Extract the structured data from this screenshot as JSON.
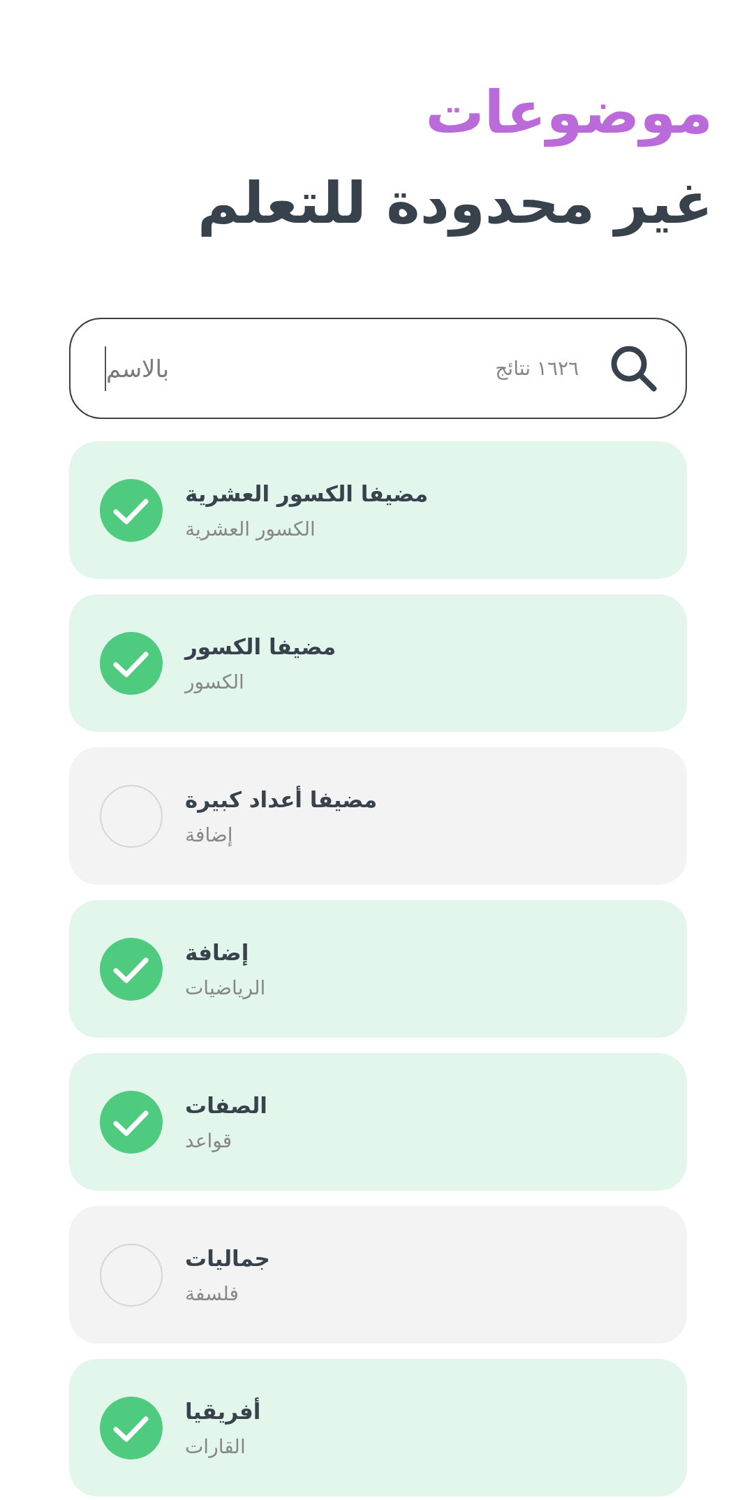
{
  "title": {
    "accent": "موضوعات",
    "main": "غير محدودة للتعلم"
  },
  "search": {
    "placeholder": "بالاسم",
    "result_count": "١٦٢٦ نتائج"
  },
  "topics": [
    {
      "title": "مضيفا الكسور العشرية",
      "subtitle": "الكسور العشرية",
      "checked": true
    },
    {
      "title": "مضيفا الكسور",
      "subtitle": "الكسور",
      "checked": true
    },
    {
      "title": "مضيفا أعداد كبيرة",
      "subtitle": "إضافة",
      "checked": false
    },
    {
      "title": "إضافة",
      "subtitle": "الرياضيات",
      "checked": true
    },
    {
      "title": "الصفات",
      "subtitle": "قواعد",
      "checked": true
    },
    {
      "title": "جماليات",
      "subtitle": "فلسفة",
      "checked": false
    },
    {
      "title": "أفريقيا",
      "subtitle": "القارات",
      "checked": true
    }
  ]
}
